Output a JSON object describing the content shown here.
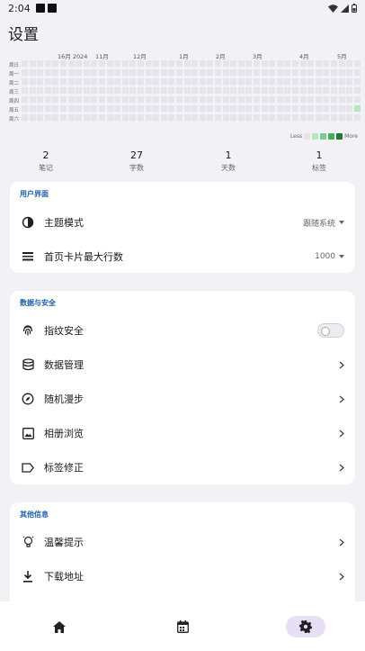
{
  "status": {
    "time": "2:04"
  },
  "page": {
    "title": "设置"
  },
  "heatmap": {
    "months": [
      "16月 2024",
      "11月",
      "12月",
      "1月",
      "2月",
      "3月",
      "4月",
      "5月"
    ],
    "days": [
      "周日",
      "周一",
      "周二",
      "周三",
      "周四",
      "周五",
      "周六"
    ],
    "legend_less": "Less",
    "legend_more": "More",
    "colors": {
      "empty": "#e4e4ea",
      "l1": "#b7e6bf",
      "l2": "#79cf89",
      "l3": "#3fae57",
      "l4": "#1f7a34"
    }
  },
  "stats": [
    {
      "value": "2",
      "label": "笔记"
    },
    {
      "value": "27",
      "label": "字数"
    },
    {
      "value": "1",
      "label": "天数"
    },
    {
      "value": "1",
      "label": "标签"
    }
  ],
  "ui_section": {
    "header": "用户界面",
    "theme_label": "主题模式",
    "theme_value": "跟随系统",
    "lines_label": "首页卡片最大行数",
    "lines_value": "1000"
  },
  "data_section": {
    "header": "数据与安全",
    "fingerprint_label": "指纹安全",
    "data_mgmt_label": "数据管理",
    "random_walk_label": "随机漫步",
    "album_label": "相册浏览",
    "tag_fix_label": "标签修正"
  },
  "other_section": {
    "header": "其他信息",
    "tips_label": "温馨提示",
    "download_label": "下载地址"
  }
}
